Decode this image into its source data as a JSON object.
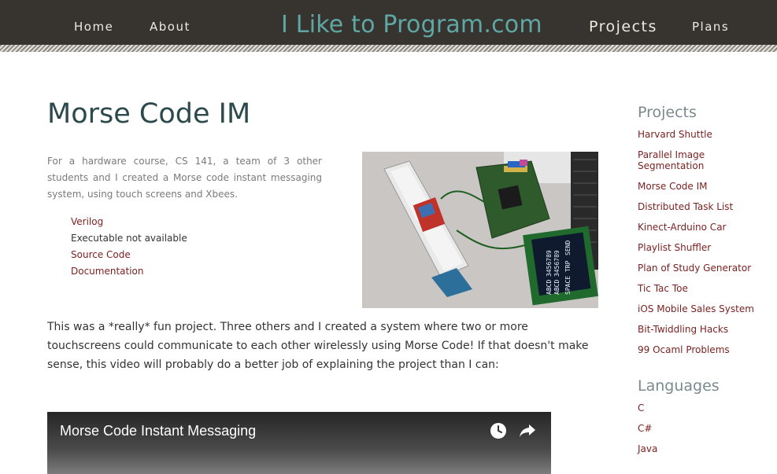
{
  "nav": {
    "home": "Home",
    "about": "About",
    "site_title": "I Like to Program.com",
    "projects": "Projects",
    "plans": "Plans"
  },
  "page": {
    "title": "Morse Code IM",
    "intro": "For a hardware course, CS 141, a team of 3 other students and I created a Morse code instant messaging system, using touch screens and Xbees.",
    "links": [
      {
        "label": "Verilog",
        "linked": true
      },
      {
        "label": "Executable not available",
        "linked": false
      },
      {
        "label": "Source Code",
        "linked": true
      },
      {
        "label": "Documentation",
        "linked": true
      }
    ],
    "body": "This was a *really* fun project. Three others and I created a system where two or more touchscreens could communicate to each other wirelessly using Morse Code! If that doesn't make sense, this video will probably do a better job of explaining the project than I can:",
    "photo_screen_text": [
      "ABCD",
      "ABCD",
      "3456789",
      "3456789",
      "SPACE",
      "TRP",
      "SEND"
    ]
  },
  "video": {
    "title": "Morse Code Instant Messaging",
    "icons": [
      "clock-icon",
      "share-icon"
    ]
  },
  "sidebar": {
    "projects_heading": "Projects",
    "projects": [
      "Harvard Shuttle",
      "Parallel Image Segmentation",
      "Morse Code IM",
      "Distributed Task List",
      "Kinect-Arduino Car",
      "Playlist Shuffler",
      "Plan of Study Generator",
      "Tic Tac Toe",
      "iOS Mobile Sales System",
      "Bit-Twiddling Hacks",
      "99 Ocaml Problems"
    ],
    "languages_heading": "Languages",
    "languages": [
      "C",
      "C#",
      "Java"
    ]
  },
  "colors": {
    "header_bg": "#37342f",
    "site_title": "#5fa7a5",
    "link": "#7a1f1f",
    "heading": "#2c4a4e"
  }
}
